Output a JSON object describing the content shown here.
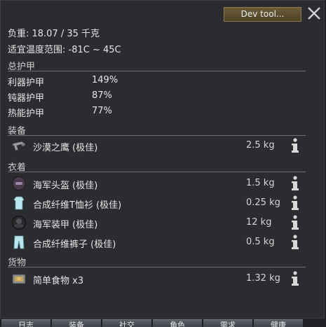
{
  "header": {
    "dev_tool_label": "Dev tool..."
  },
  "stats": {
    "mass_text": "负重:  18.07 / 35 千克",
    "comfy_temp_text": "适宜温度范围: -81C ~ 45C"
  },
  "armor": {
    "title": "总护甲",
    "rows": [
      {
        "name": "利器护甲",
        "value": "149%"
      },
      {
        "name": "钝器护甲",
        "value": "87%"
      },
      {
        "name": "热能护甲",
        "value": "77%"
      }
    ]
  },
  "equipment": {
    "title": "装备",
    "items": [
      {
        "name": "沙漠之鹰 (极佳)",
        "weight": "2.5 kg",
        "icon": "pistol-icon"
      }
    ]
  },
  "apparel": {
    "title": "衣着",
    "items": [
      {
        "name": "海军头盔 (极佳)",
        "weight": "1.5 kg",
        "icon": "helmet-icon"
      },
      {
        "name": "合成纤维T恤衫 (极佳)",
        "weight": "0.25 kg",
        "icon": "tshirt-icon"
      },
      {
        "name": "海军装甲 (极佳)",
        "weight": "12 kg",
        "icon": "armor-icon"
      },
      {
        "name": "合成纤维裤子 (极佳)",
        "weight": "0.5 kg",
        "icon": "pants-icon"
      }
    ]
  },
  "inventory": {
    "title": "货物",
    "items": [
      {
        "name": "简单食物 x3",
        "weight": "1.32 kg",
        "icon": "meal-icon"
      }
    ]
  },
  "bottom_tabs": [
    "日志",
    "装备",
    "社交",
    "角色",
    "需求",
    "健康"
  ],
  "colors": {
    "panel_bg": "#2a2c30",
    "dev_button": "#5e5030",
    "rule": "#6b6d70"
  }
}
